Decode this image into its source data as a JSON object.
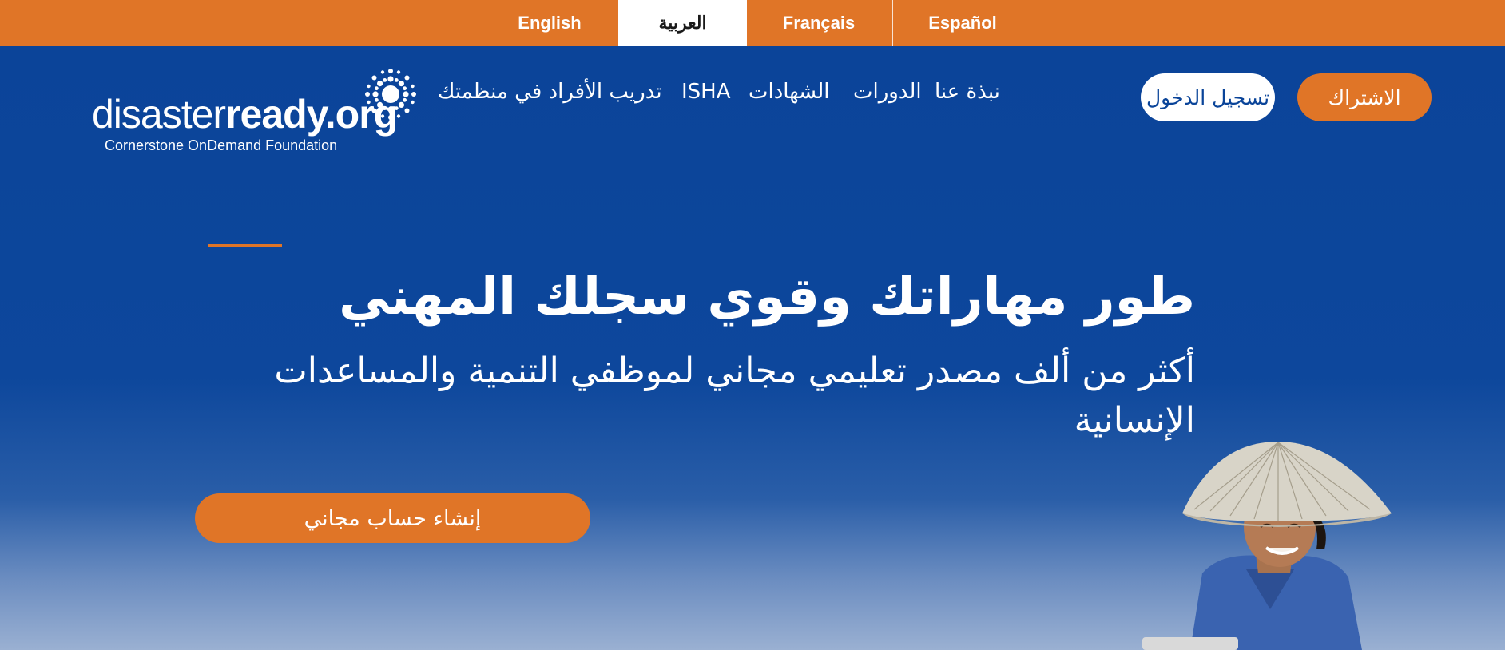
{
  "languages": [
    {
      "label": "English"
    },
    {
      "label": "العربية"
    },
    {
      "label": "Français"
    },
    {
      "label": "Español"
    }
  ],
  "logo": {
    "name_light": "disaster",
    "name_bold": "ready.org",
    "subtitle": "Cornerstone OnDemand Foundation"
  },
  "nav": {
    "about": "نبذة عنا",
    "courses": "الدورات",
    "certificates": "الشهادات",
    "isha": "ISHA",
    "org_training": "تدريب الأفراد في منظمتك"
  },
  "header": {
    "login_label": "تسجيل الدخول",
    "subscribe_label": "الاشتراك"
  },
  "hero": {
    "title": "طور مهاراتك وقوي سجلك المهني",
    "subtitle": "أكثر من ألف مصدر تعليمي مجاني لموظفي التنمية والمساعدات الإنسانية",
    "cta_label": "إنشاء حساب مجاني"
  },
  "colors": {
    "accent_orange": "#e07527",
    "brand_blue": "#0a4499",
    "white": "#ffffff"
  }
}
